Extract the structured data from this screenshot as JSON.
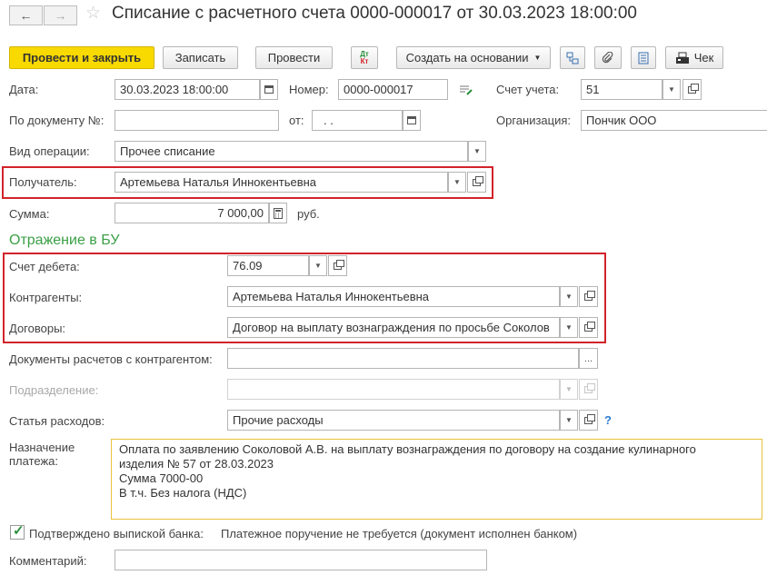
{
  "nav": {
    "back": "←",
    "forward": "→"
  },
  "title": "Списание с расчетного счета 0000-000017 от 30.03.2023 18:00:00",
  "toolbar": {
    "post_close": "Провести и закрыть",
    "save": "Записать",
    "post": "Провести",
    "dtkt_top": "Дт",
    "dtkt_bottom": "Кт",
    "create_based": "Создать на основании",
    "check": "Чек"
  },
  "fields": {
    "date_label": "Дата:",
    "date_value": "30.03.2023 18:00:00",
    "number_label": "Номер:",
    "number_value": "0000-000017",
    "account_label": "Счет учета:",
    "account_value": "51",
    "doc_no_label": "По документу №:",
    "doc_no_value": "",
    "from_label": "от:",
    "from_value": ".  .",
    "org_label": "Организация:",
    "org_value": "Пончик ООО",
    "op_type_label": "Вид операции:",
    "op_type_value": "Прочее списание",
    "recipient_label": "Получатель:",
    "recipient_value": "Артемьева Наталья Иннокентьевна",
    "sum_label": "Сумма:",
    "sum_value": "7 000,00",
    "currency": "руб."
  },
  "section_title": "Отражение в БУ",
  "accounting": {
    "debit_label": "Счет дебета:",
    "debit_value": "76.09",
    "counterparty_label": "Контрагенты:",
    "counterparty_value": "Артемьева Наталья Иннокентьевна",
    "contracts_label": "Договоры:",
    "contracts_value": "Договор на выплату вознаграждения по просьбе Соколов",
    "settle_docs_label": "Документы расчетов с контрагентом:",
    "settle_docs_value": "",
    "settle_docs_btn": "...",
    "division_label": "Подразделение:",
    "division_value": "",
    "expense_label": "Статья расходов:",
    "expense_value": "Прочие расходы",
    "help": "?"
  },
  "purpose": {
    "label_line1": "Назначение",
    "label_line2": "платежа:",
    "lines": [
      "Оплата по заявлению Соколовой А.В. на выплату вознаграждения по договору на создание кулинарного",
      "изделия № 57 от 28.03.2023",
      "Сумма 7000-00",
      "В т.ч. Без налога (НДС)"
    ]
  },
  "bank": {
    "confirmed_label": "Подтверждено выпиской банка:",
    "checked": true,
    "note": "Платежное поручение не требуется (документ исполнен банком)"
  },
  "comment": {
    "label": "Комментарий:",
    "value": ""
  },
  "colors": {
    "primary_button": "#f8d900",
    "highlight_border": "#d2232a",
    "section_title": "#3a9f45",
    "memo_border": "#e7c23a"
  }
}
